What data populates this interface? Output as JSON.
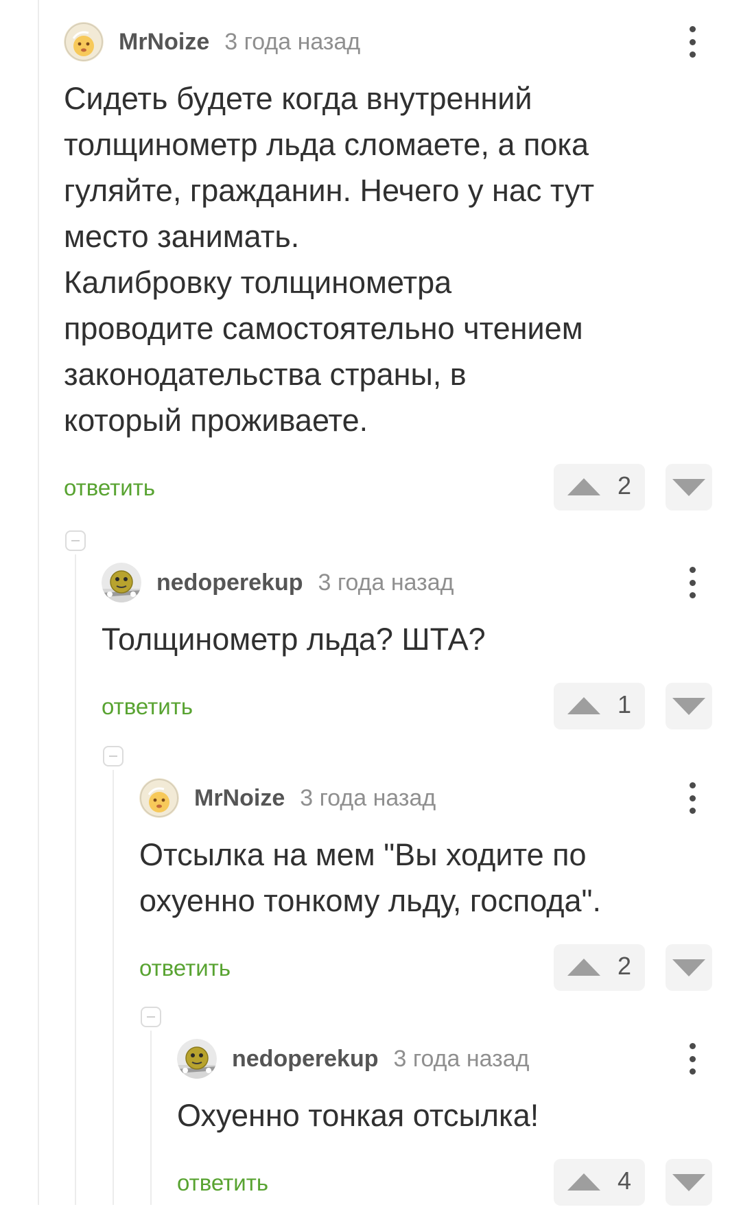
{
  "comments": [
    {
      "author": "MrNoize",
      "time": "3 года назад",
      "avatar": "face-emoji-avatar",
      "text": "Сидеть будете когда внутренний\nтолщинометр льда сломаете, а пока\nгуляйте, гражданин. Нечего у нас тут\nместо занимать.\nКалибровку толщинометра\nпроводите самостоятельно чтением\nзаконодательства страны, в\nкоторый проживаете.",
      "reply_label": "ответить",
      "rating": "2"
    },
    {
      "author": "nedoperekup",
      "time": "3 года назад",
      "avatar": "yellow-ball-avatar",
      "text": "Толщинометр льда? ШТА?",
      "reply_label": "ответить",
      "rating": "1"
    },
    {
      "author": "MrNoize",
      "time": "3 года назад",
      "avatar": "face-emoji-avatar",
      "text": "Отсылка на мем \"Вы ходите по\nохуенно тонкому льду, господа\".",
      "reply_label": "ответить",
      "rating": "2"
    },
    {
      "author": "nedoperekup",
      "time": "3 года назад",
      "avatar": "yellow-ball-avatar",
      "text": "Охуенно тонкая отсылка!",
      "reply_label": "ответить",
      "rating": "4"
    }
  ],
  "colors": {
    "reply_link": "#58a331",
    "author": "#555555",
    "timestamp": "#8f8f8f",
    "body_text": "#303030",
    "vote_bg": "#f3f3f3",
    "vote_arrow": "#9e9e9e",
    "thread_line": "#ececec"
  },
  "icons": {
    "upvote": "triangle-up-icon",
    "downvote": "triangle-down-icon",
    "more": "vertical-dots-icon",
    "collapse": "minus-square-icon"
  }
}
